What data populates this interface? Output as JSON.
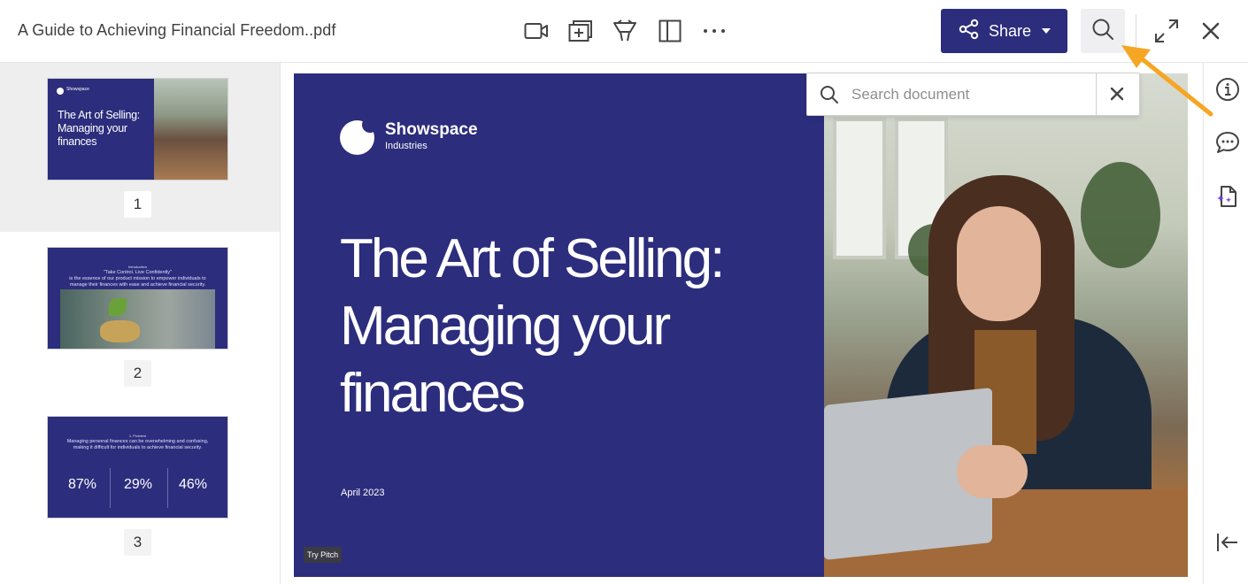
{
  "document": {
    "title": "A Guide to Achieving Financial Freedom..pdf"
  },
  "toolbar": {
    "icons": [
      "video-icon",
      "add-page-icon",
      "annotate-icon",
      "sidebar-toggle-icon",
      "more-icon"
    ],
    "share_label": "Share",
    "accent_color": "#2c2d7c"
  },
  "search": {
    "placeholder": "Search document",
    "value": ""
  },
  "thumbnails": [
    {
      "page": "1",
      "brand": "Showspace",
      "title": "The Art of Selling: Managing your finances"
    },
    {
      "page": "2",
      "heading_small": "Introduction",
      "quote": "\"Take Control. Live Confidently\"",
      "body": "is the essence of our product mission to empower individuals to manage their finances with ease and achieve financial security."
    },
    {
      "page": "3",
      "heading_small": "1. Problem",
      "body": "Managing personal finances can be overwhelming and confusing, making it difficult for individuals to achieve financial security.",
      "stats": [
        "87%",
        "29%",
        "46%"
      ]
    }
  ],
  "slide": {
    "brand": "Showspace",
    "brand_sub": "Industries",
    "title_lines": [
      "The Art of Selling:",
      "Managing your",
      "finances"
    ],
    "date": "April 2023",
    "badge": "Try Pitch",
    "background_color": "#2c2d7c"
  },
  "rail": {
    "icons": [
      "info-icon",
      "comment-icon",
      "ai-document-icon",
      "collapse-panel-icon"
    ]
  },
  "callout": {
    "color": "#f5a623"
  }
}
